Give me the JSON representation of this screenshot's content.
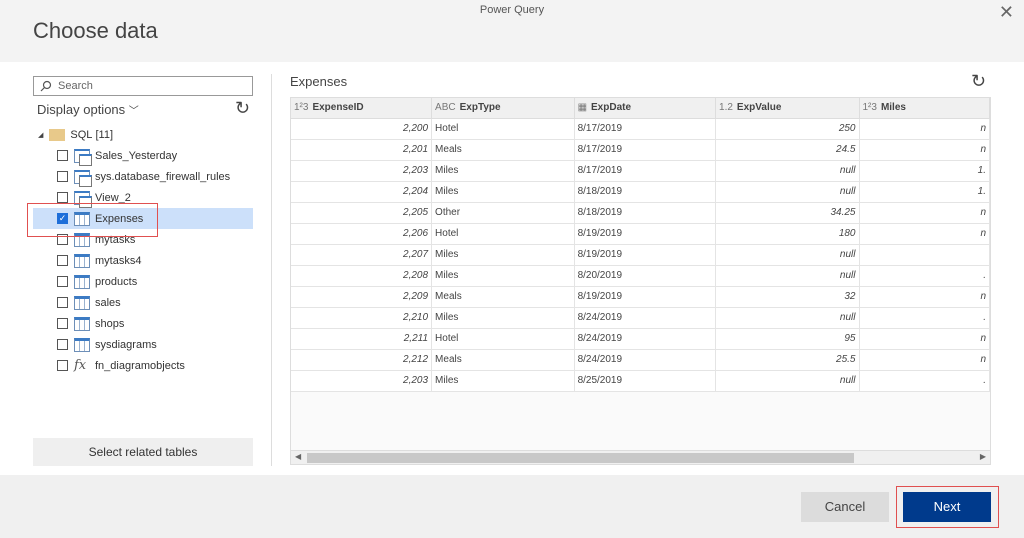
{
  "window": {
    "title": "Power Query",
    "heading": "Choose data"
  },
  "navigator": {
    "search_placeholder": "Search",
    "display_options": "Display options",
    "root": {
      "label": "SQL",
      "count": "[11]"
    },
    "items": [
      {
        "label": "Sales_Yesterday",
        "icon": "view",
        "checked": false
      },
      {
        "label": "sys.database_firewall_rules",
        "icon": "view",
        "checked": false
      },
      {
        "label": "View_2",
        "icon": "view",
        "checked": false
      },
      {
        "label": "Expenses",
        "icon": "table",
        "checked": true
      },
      {
        "label": "mytasks",
        "icon": "table",
        "checked": false
      },
      {
        "label": "mytasks4",
        "icon": "table",
        "checked": false
      },
      {
        "label": "products",
        "icon": "table",
        "checked": false
      },
      {
        "label": "sales",
        "icon": "table",
        "checked": false
      },
      {
        "label": "shops",
        "icon": "table",
        "checked": false
      },
      {
        "label": "sysdiagrams",
        "icon": "table",
        "checked": false
      },
      {
        "label": "fn_diagramobjects",
        "icon": "function",
        "checked": false
      }
    ],
    "select_related": "Select related tables"
  },
  "preview": {
    "title": "Expenses",
    "columns": [
      {
        "type_icon": "1²3",
        "name": "ExpenseID"
      },
      {
        "type_icon": "ABC",
        "name": "ExpType"
      },
      {
        "type_icon": "calendar",
        "name": "ExpDate"
      },
      {
        "type_icon": "1.2",
        "name": "ExpValue"
      },
      {
        "type_icon": "1²3",
        "name": "Miles"
      }
    ],
    "rows": [
      [
        "2,200",
        "Hotel",
        "8/17/2019",
        "250",
        "n"
      ],
      [
        "2,201",
        "Meals",
        "8/17/2019",
        "24.5",
        "n"
      ],
      [
        "2,203",
        "Miles",
        "8/17/2019",
        "null",
        "1."
      ],
      [
        "2,204",
        "Miles",
        "8/18/2019",
        "null",
        "1."
      ],
      [
        "2,205",
        "Other",
        "8/18/2019",
        "34.25",
        "n"
      ],
      [
        "2,206",
        "Hotel",
        "8/19/2019",
        "180",
        "n"
      ],
      [
        "2,207",
        "Miles",
        "8/19/2019",
        "null",
        ""
      ],
      [
        "2,208",
        "Miles",
        "8/20/2019",
        "null",
        "."
      ],
      [
        "2,209",
        "Meals",
        "8/19/2019",
        "32",
        "n"
      ],
      [
        "2,210",
        "Miles",
        "8/24/2019",
        "null",
        "."
      ],
      [
        "2,211",
        "Hotel",
        "8/24/2019",
        "95",
        "n"
      ],
      [
        "2,212",
        "Meals",
        "8/24/2019",
        "25.5",
        "n"
      ],
      [
        "2,203",
        "Miles",
        "8/25/2019",
        "null",
        "."
      ]
    ]
  },
  "footer": {
    "cancel": "Cancel",
    "next": "Next"
  },
  "colors": {
    "accent": "#003a8c",
    "highlight": "#e05050",
    "selection": "#cce0fa"
  }
}
